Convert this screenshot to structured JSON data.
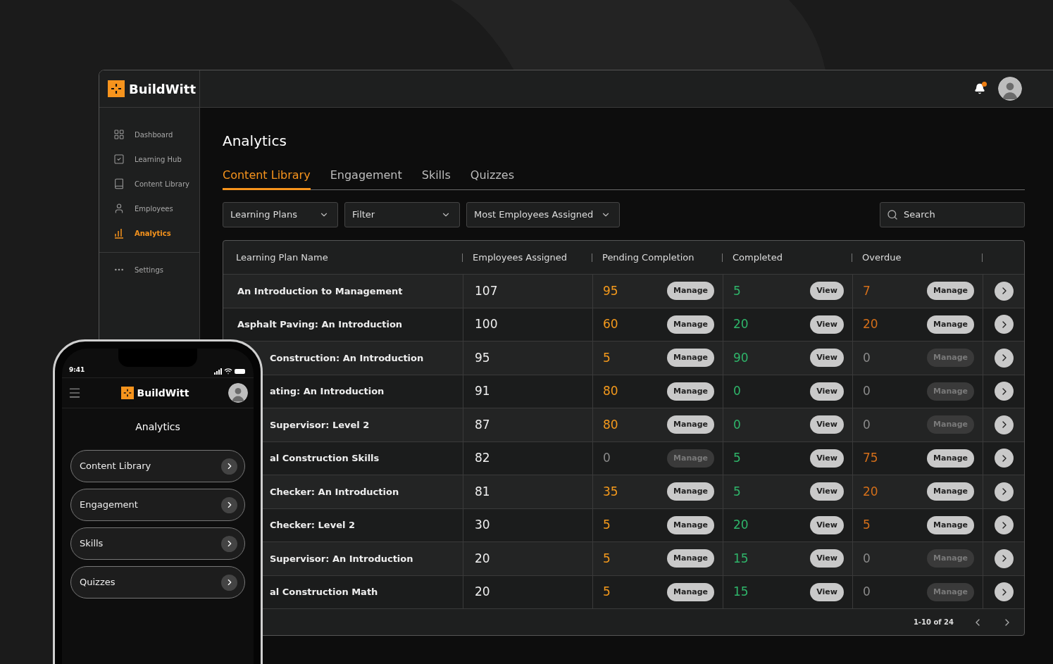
{
  "desktop": {
    "brand": "BuildWitt",
    "sidebar": {
      "items": [
        {
          "label": "Dashboard",
          "selected": false
        },
        {
          "label": "Learning Hub",
          "selected": false
        },
        {
          "label": "Content Library",
          "selected": false
        },
        {
          "label": "Employees",
          "selected": false
        },
        {
          "label": "Analytics",
          "selected": true
        }
      ],
      "settings": {
        "label": "Settings"
      }
    },
    "header": {
      "notification": true
    },
    "page_title": "Analytics",
    "tabs": [
      {
        "label": "Content Library",
        "selected": true
      },
      {
        "label": "Engagement",
        "selected": false
      },
      {
        "label": "Skills",
        "selected": false
      },
      {
        "label": "Quizzes",
        "selected": false
      }
    ],
    "filters": [
      {
        "value": "Learning Plans"
      },
      {
        "value": "Filter"
      },
      {
        "value": "Most Employees Assigned"
      }
    ],
    "search": {
      "placeholder": "Search"
    },
    "table": {
      "columns": [
        "Learning Plan Name",
        "Employees Assigned",
        "Pending Completion",
        "Completed",
        "Overdue"
      ],
      "rows": [
        {
          "name": "An Introduction to Management",
          "employees": "107",
          "pending": {
            "value": "95",
            "color": "#f59a1c",
            "action": "Manage",
            "disabled": false
          },
          "completed": {
            "value": "5",
            "color": "#2fb56a",
            "action": "View",
            "disabled": false
          },
          "overdue": {
            "value": "7",
            "color": "#d46f1a",
            "action": "Manage",
            "disabled": false
          }
        },
        {
          "name": "Asphalt Paving: An Introduction",
          "employees": "100",
          "pending": {
            "value": "60",
            "color": "#f59a1c",
            "action": "Manage",
            "disabled": false
          },
          "completed": {
            "value": "20",
            "color": "#2fb56a",
            "action": "View",
            "disabled": false
          },
          "overdue": {
            "value": "20",
            "color": "#d46f1a",
            "action": "Manage",
            "disabled": false
          }
        },
        {
          "name": "Construction: An Introduction",
          "employees": "95",
          "pending": {
            "value": "5",
            "color": "#f59a1c",
            "action": "Manage",
            "disabled": false
          },
          "completed": {
            "value": "90",
            "color": "#2fb56a",
            "action": "View",
            "disabled": false
          },
          "overdue": {
            "value": "0",
            "color": "#8a8a8a",
            "action": "Manage",
            "disabled": true
          }
        },
        {
          "name": "ating: An Introduction",
          "employees": "91",
          "pending": {
            "value": "80",
            "color": "#f59a1c",
            "action": "Manage",
            "disabled": false
          },
          "completed": {
            "value": "0",
            "color": "#2fb56a",
            "action": "View",
            "disabled": false
          },
          "overdue": {
            "value": "0",
            "color": "#8a8a8a",
            "action": "Manage",
            "disabled": true
          }
        },
        {
          "name": "Supervisor: Level 2",
          "employees": "87",
          "pending": {
            "value": "80",
            "color": "#f59a1c",
            "action": "Manage",
            "disabled": false
          },
          "completed": {
            "value": "0",
            "color": "#2fb56a",
            "action": "View",
            "disabled": false
          },
          "overdue": {
            "value": "0",
            "color": "#8a8a8a",
            "action": "Manage",
            "disabled": true
          }
        },
        {
          "name": "al Construction Skills",
          "employees": "82",
          "pending": {
            "value": "0",
            "color": "#8a8a8a",
            "action": "Manage",
            "disabled": true
          },
          "completed": {
            "value": "5",
            "color": "#2fb56a",
            "action": "View",
            "disabled": false
          },
          "overdue": {
            "value": "75",
            "color": "#d46f1a",
            "action": "Manage",
            "disabled": false
          }
        },
        {
          "name": "Checker: An Introduction",
          "employees": "81",
          "pending": {
            "value": "35",
            "color": "#f59a1c",
            "action": "Manage",
            "disabled": false
          },
          "completed": {
            "value": "5",
            "color": "#2fb56a",
            "action": "View",
            "disabled": false
          },
          "overdue": {
            "value": "20",
            "color": "#d46f1a",
            "action": "Manage",
            "disabled": false
          }
        },
        {
          "name": "Checker: Level 2",
          "employees": "30",
          "pending": {
            "value": "5",
            "color": "#f59a1c",
            "action": "Manage",
            "disabled": false
          },
          "completed": {
            "value": "20",
            "color": "#2fb56a",
            "action": "View",
            "disabled": false
          },
          "overdue": {
            "value": "5",
            "color": "#d46f1a",
            "action": "Manage",
            "disabled": false
          }
        },
        {
          "name": "Supervisor: An Introduction",
          "employees": "20",
          "pending": {
            "value": "5",
            "color": "#f59a1c",
            "action": "Manage",
            "disabled": false
          },
          "completed": {
            "value": "15",
            "color": "#2fb56a",
            "action": "View",
            "disabled": false
          },
          "overdue": {
            "value": "0",
            "color": "#8a8a8a",
            "action": "Manage",
            "disabled": true
          }
        },
        {
          "name": "al Construction Math",
          "employees": "20",
          "pending": {
            "value": "5",
            "color": "#f59a1c",
            "action": "Manage",
            "disabled": false
          },
          "completed": {
            "value": "15",
            "color": "#2fb56a",
            "action": "View",
            "disabled": false
          },
          "overdue": {
            "value": "0",
            "color": "#8a8a8a",
            "action": "Manage",
            "disabled": true
          }
        }
      ],
      "pagination": "1-10 of 24"
    }
  },
  "phone": {
    "time": "9:41",
    "brand": "BuildWitt",
    "title": "Analytics",
    "menu": [
      {
        "label": "Content Library"
      },
      {
        "label": "Engagement"
      },
      {
        "label": "Skills"
      },
      {
        "label": "Quizzes"
      }
    ]
  }
}
